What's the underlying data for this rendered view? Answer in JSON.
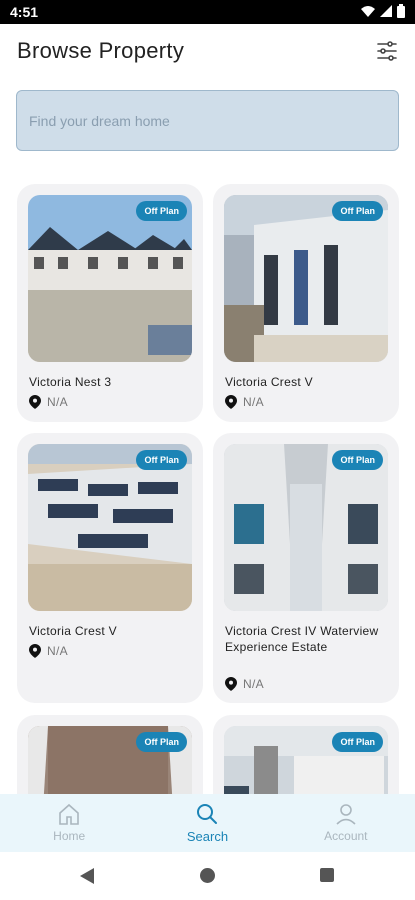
{
  "status_bar": {
    "time": "4:51"
  },
  "header": {
    "title": "Browse Property"
  },
  "search": {
    "placeholder": "Find your dream home"
  },
  "properties": [
    {
      "title": "Victoria Nest 3",
      "badge": "Off Plan",
      "location": "N/A"
    },
    {
      "title": "Victoria Crest V",
      "badge": "Off Plan",
      "location": "N/A"
    },
    {
      "title": "Victoria Crest V",
      "badge": "Off Plan",
      "location": "N/A"
    },
    {
      "title": "Victoria  Crest IV Waterview Experience Estate",
      "badge": "Off Plan",
      "location": "N/A"
    },
    {
      "title": "",
      "badge": "Off Plan",
      "location": ""
    },
    {
      "title": "",
      "badge": "Off Plan",
      "location": ""
    }
  ],
  "bottom_nav": [
    {
      "label": "Home",
      "icon": "home-icon",
      "active": false
    },
    {
      "label": "Search",
      "icon": "search-icon",
      "active": true
    },
    {
      "label": "Account",
      "icon": "account-icon",
      "active": false
    }
  ],
  "colors": {
    "accent": "#1b84b6",
    "search_bg": "#cfdde9",
    "card_bg": "#f2f2f4",
    "nav_bg": "#eaf6fb"
  }
}
